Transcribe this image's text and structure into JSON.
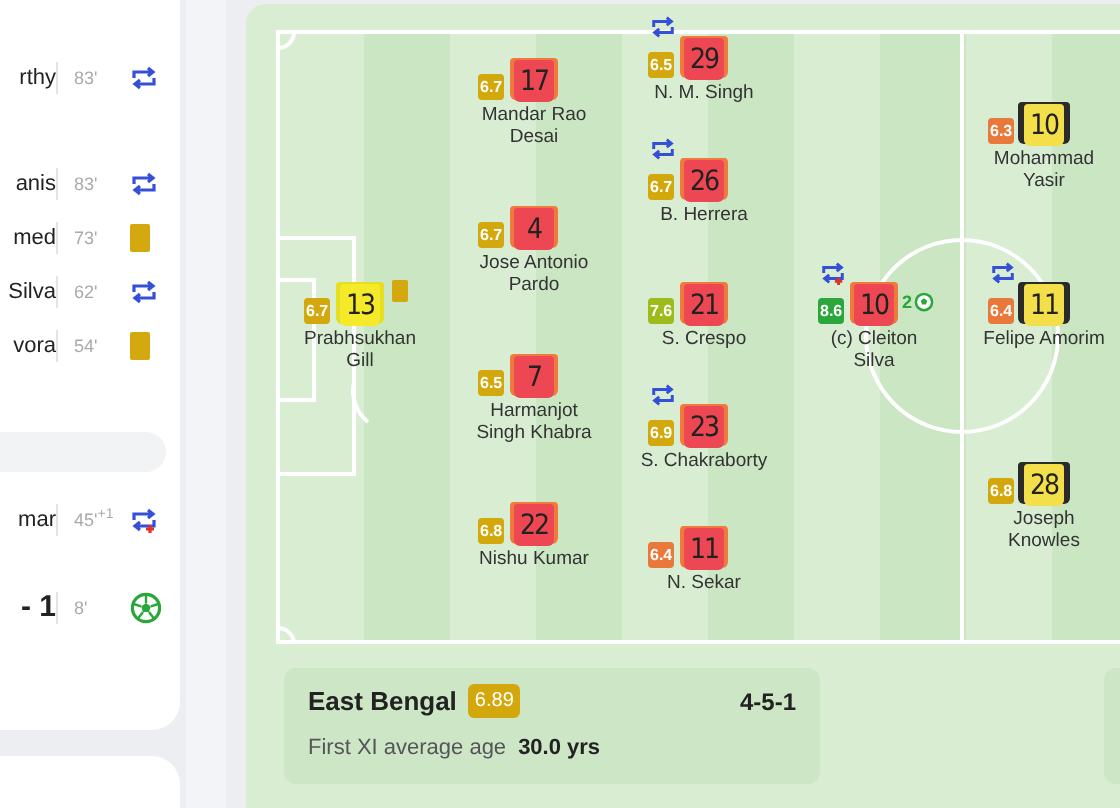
{
  "events_panel": {
    "groups": [
      {
        "rows": [
          {
            "name": "rthy",
            "minute": "83'",
            "kind": "sub"
          }
        ]
      },
      {
        "rows": [
          {
            "name": "anis",
            "minute": "83'",
            "kind": "sub"
          },
          {
            "name": "med",
            "minute": "73'",
            "kind": "booking"
          },
          {
            "name": "Silva",
            "minute": "62'",
            "kind": "sub"
          },
          {
            "name": "vora",
            "minute": "54'",
            "kind": "booking"
          }
        ]
      },
      {
        "header": true,
        "rows": [
          {
            "name": "mar",
            "minute": "45'$^{+1}$",
            "kind": "sub_plus"
          }
        ]
      },
      {
        "rows": [
          {
            "name": "- 1",
            "minute": "8'",
            "kind": "goal",
            "score": true
          }
        ]
      }
    ]
  },
  "pitch": {
    "players": [
      {
        "name": "Prabhsukhan Gill",
        "number": "13",
        "rating": "6.7",
        "color": "#d2a80c",
        "kind": "keeper",
        "events": [
          {
            "kind": "booking"
          }
        ]
      },
      {
        "name": "Mandar Rao Desai",
        "number": "17",
        "rating": "6.7",
        "color": "#d2a80c",
        "kind": "home"
      },
      {
        "name": "Jose Antonio Pardo",
        "number": "4",
        "rating": "6.7",
        "color": "#d2a80c",
        "kind": "home"
      },
      {
        "name": "Harmanjot Singh Khabra",
        "number": "7",
        "rating": "6.5",
        "color": "#d2a80c",
        "kind": "home"
      },
      {
        "name": "Nishu Kumar",
        "number": "22",
        "rating": "6.8",
        "color": "#d2a80c",
        "kind": "home"
      },
      {
        "name": "N. M. Singh",
        "number": "29",
        "rating": "6.5",
        "color": "#d2a80c",
        "kind": "home",
        "events": [
          {
            "kind": "sub"
          }
        ]
      },
      {
        "name": "B. Herrera",
        "number": "26",
        "rating": "6.7",
        "color": "#d2a80c",
        "kind": "home",
        "events": [
          {
            "kind": "sub"
          }
        ]
      },
      {
        "name": "S. Crespo",
        "number": "21",
        "rating": "7.6",
        "color": "#9cbc1c",
        "kind": "home"
      },
      {
        "name": "S. Chakraborty",
        "number": "23",
        "rating": "6.9",
        "color": "#d2a80c",
        "kind": "home",
        "events": [
          {
            "kind": "sub"
          }
        ]
      },
      {
        "name": "N. Sekar",
        "number": "11",
        "rating": "6.4",
        "color": "#e8793a",
        "kind": "home"
      },
      {
        "name": "(c) Cleiton Silva",
        "number": "10",
        "rating": "8.6",
        "color": "#2aa63a",
        "kind": "home",
        "events": [
          {
            "kind": "sub_plus"
          },
          {
            "kind": "goal",
            "count": "2"
          }
        ]
      },
      {
        "name": "Mohammad Yasir",
        "number": "10",
        "rating": "6.3",
        "color": "#e8793a",
        "kind": "away"
      },
      {
        "name": "Felipe Amorim",
        "number": "11",
        "rating": "6.4",
        "color": "#e8793a",
        "kind": "away",
        "events": [
          {
            "kind": "sub"
          }
        ]
      },
      {
        "name": "Joseph Knowles",
        "number": "28",
        "rating": "6.8",
        "color": "#d2a80c",
        "kind": "away"
      }
    ]
  },
  "team_summary": {
    "team": "East Bengal",
    "rating": "6.89",
    "formation": "4-5-1",
    "age_label": "First XI average age",
    "age_value": "30.0 yrs"
  }
}
